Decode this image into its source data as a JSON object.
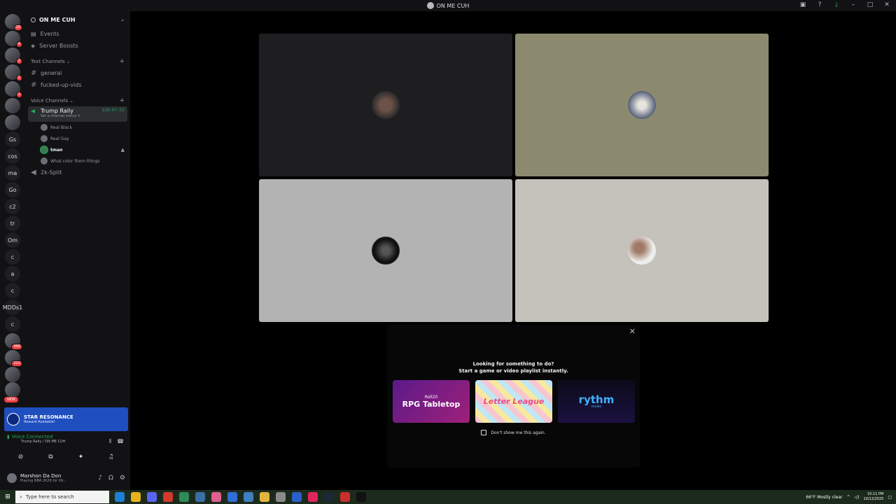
{
  "window": {
    "title": "ON ME CUH"
  },
  "rail": {
    "servers": [
      {
        "label": "",
        "badge": "18"
      },
      {
        "label": "",
        "badge": "4"
      },
      {
        "label": "",
        "badge": "2"
      },
      {
        "label": "",
        "badge": "1"
      },
      {
        "label": "",
        "badge": "1"
      },
      {
        "label": "",
        "badge": ""
      },
      {
        "label": "",
        "badge": ""
      },
      {
        "label": "Gs",
        "badge": ""
      },
      {
        "label": "cos",
        "badge": ""
      },
      {
        "label": "ma",
        "badge": ""
      },
      {
        "label": "Go",
        "badge": ""
      },
      {
        "label": "c2",
        "badge": ""
      },
      {
        "label": "tr",
        "badge": ""
      },
      {
        "label": "Om",
        "badge": ""
      },
      {
        "label": "c",
        "badge": ""
      },
      {
        "label": "a",
        "badge": ""
      },
      {
        "label": "c",
        "badge": ""
      },
      {
        "label": "MDDs1",
        "badge": ""
      },
      {
        "label": "c",
        "badge": ""
      },
      {
        "label": "",
        "badge": "466"
      },
      {
        "label": "",
        "badge": "222"
      },
      {
        "label": "",
        "badge": ""
      },
      {
        "label": "",
        "badge": ""
      }
    ],
    "new_badge": "NEW"
  },
  "sidebar": {
    "server_name": "ON ME CUH",
    "events": "Events",
    "boosts": "Server Boosts",
    "text_category": "Text Channels",
    "text_channels": [
      "general",
      "fucked-up-vids"
    ],
    "voice_category": "Voice Channels",
    "active_channel": {
      "name": "Trump Rally",
      "timer": "210:07:52",
      "status": "Set a channel status"
    },
    "voice_users": [
      "Real Black",
      "Real Gay",
      "tman",
      "What color them things"
    ],
    "other_voice_channel": "2k-Split"
  },
  "promo": {
    "title": "STAR RESONANCE",
    "subtitle": "Reward Available!"
  },
  "voice_panel": {
    "status": "Voice Connected",
    "location": "Trump Rally / ON ME CUH"
  },
  "user": {
    "name": "Marshon Da Don",
    "status": "Playing NBA 2K26 for Xb..."
  },
  "activity": {
    "heading": "Looking for something to do?",
    "subheading": "Start a game or video playlist instantly.",
    "cards": [
      {
        "brand": "Roll20",
        "title": "RPG Tabletop"
      },
      {
        "brand": "Letter League",
        "title": "Letter League"
      },
      {
        "brand": "rythm",
        "title": "music"
      }
    ],
    "dont_show": "Don't show me this again."
  },
  "taskbar": {
    "search_placeholder": "Type here to search",
    "weather": "66°F  Mostly clear",
    "time": "10:11 PM",
    "date": "10/12/2025"
  },
  "colors": {
    "accent_green": "#23a55a",
    "promo_blue": "#1f4ebf",
    "tile_1": "#1e1e21",
    "tile_2": "#8b8a6e",
    "tile_3": "#b3b3b3",
    "tile_4": "#c5c2bc"
  }
}
